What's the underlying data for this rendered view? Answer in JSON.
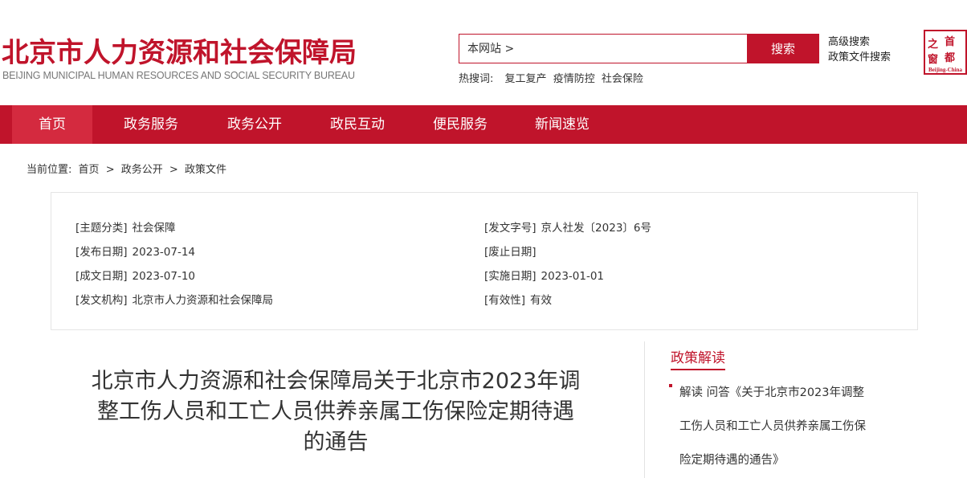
{
  "header": {
    "title": "北京市人力资源和社会保障局",
    "subtitle": "BEIJING MUNICIPAL HUMAN RESOURCES AND SOCIAL SECURITY BUREAU",
    "search": {
      "scope": "本网站 >",
      "button_label": "搜索",
      "placeholder": ""
    },
    "advanced_search": "高级搜索",
    "policy_search": "政策文件搜索",
    "hot_search": {
      "label": "热搜词:",
      "items": [
        "复工复产",
        "疫情防控",
        "社会保险"
      ]
    },
    "logo": {
      "chars": [
        "首",
        "都",
        "之",
        "窗"
      ],
      "text": "Beijing-China"
    }
  },
  "nav": {
    "items": [
      "首页",
      "政务服务",
      "政务公开",
      "政民互动",
      "便民服务",
      "新闻速览"
    ]
  },
  "breadcrumb": {
    "label": "当前位置:",
    "items": [
      "首页",
      ">",
      "政务公开",
      ">",
      "政策文件"
    ]
  },
  "info": {
    "topic": {
      "label": "[主题分类]",
      "value": "社会保障"
    },
    "doc_no": {
      "label": "[发文字号]",
      "value": "京人社发〔2023〕6号"
    },
    "publish_date": {
      "label": "[发布日期]",
      "value": "2023-07-14"
    },
    "repeal_date": {
      "label": "[废止日期]",
      "value": ""
    },
    "created_date": {
      "label": "[成文日期]",
      "value": "2023-07-10"
    },
    "effective_date": {
      "label": "[实施日期]",
      "value": "2023-01-01"
    },
    "agency": {
      "label": "[发文机构]",
      "value": "北京市人力资源和社会保障局"
    },
    "validity": {
      "label": "[有效性]",
      "value": "有效"
    }
  },
  "article": {
    "title_lines": [
      "北京市人力资源和社会保障局关于北京市2023年调",
      "整工伤人员和工亡人员供养亲属工伤保险定期待遇",
      "的通告"
    ]
  },
  "sidebar": {
    "title": "政策解读",
    "item_lines": [
      "解读 问答《关于北京市2023年调整",
      "工伤人员和工亡人员供养亲属工伤保",
      "险定期待遇的通告》"
    ]
  },
  "colors": {
    "brand_red": "#c0142b",
    "nav_active": "#d42a3f"
  }
}
